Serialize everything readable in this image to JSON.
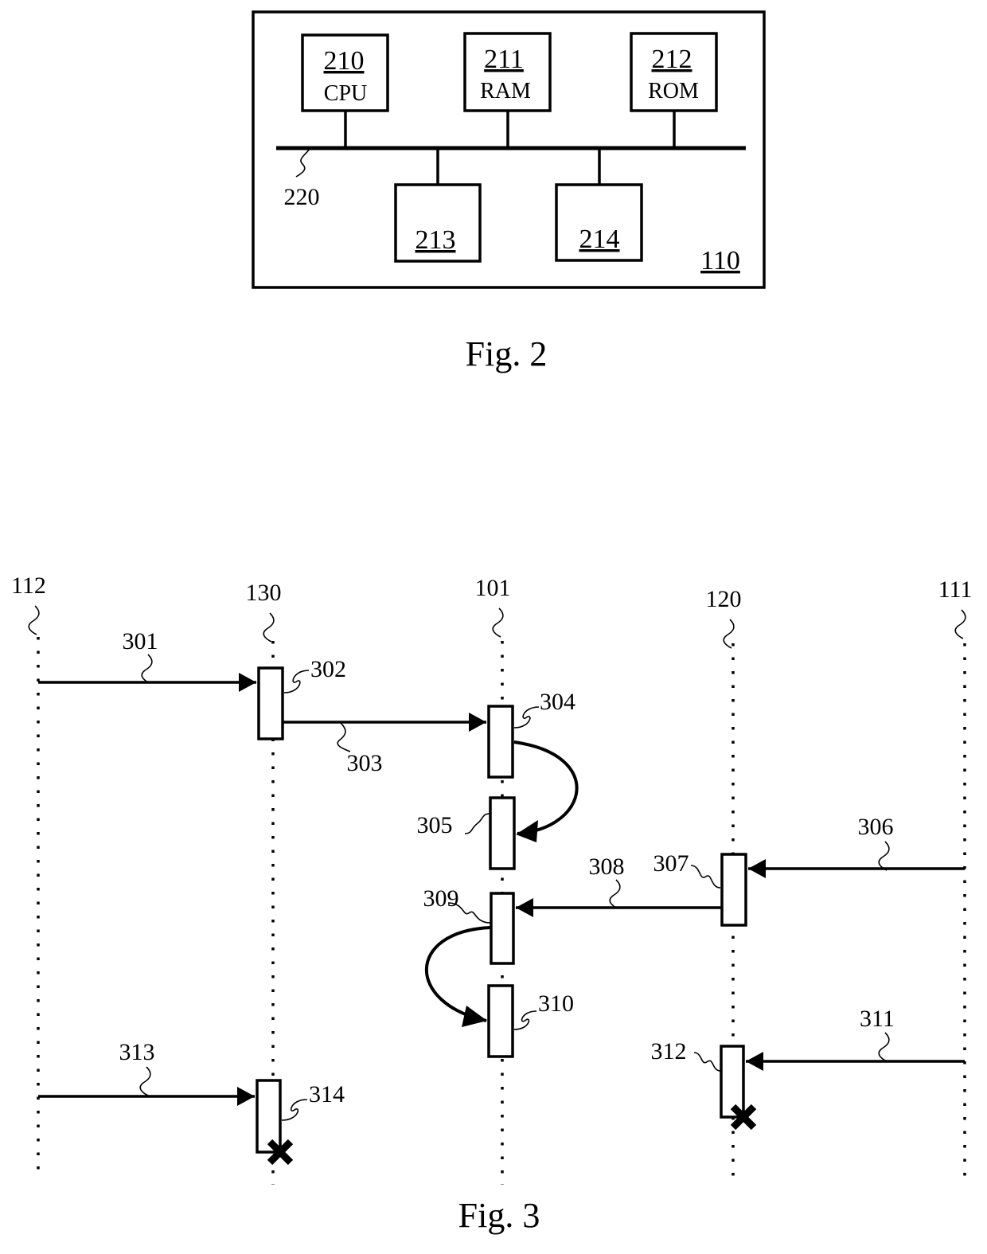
{
  "figure2": {
    "caption": "Fig. 2",
    "container_ref": "110",
    "bus_ref": "220",
    "components": [
      {
        "ref": "210",
        "label": "CPU",
        "position": "top"
      },
      {
        "ref": "211",
        "label": "RAM",
        "position": "top"
      },
      {
        "ref": "212",
        "label": "ROM",
        "position": "top"
      },
      {
        "ref": "213",
        "label": "",
        "position": "bottom"
      },
      {
        "ref": "214",
        "label": "",
        "position": "bottom"
      }
    ]
  },
  "figure3": {
    "caption": "Fig. 3",
    "lifelines": [
      {
        "ref": "112"
      },
      {
        "ref": "130"
      },
      {
        "ref": "101"
      },
      {
        "ref": "120"
      },
      {
        "ref": "111"
      }
    ],
    "activations": [
      {
        "ref": "302",
        "lifeline": "130",
        "terminated": false
      },
      {
        "ref": "304",
        "lifeline": "101",
        "terminated": false
      },
      {
        "ref": "305",
        "lifeline": "101",
        "terminated": false
      },
      {
        "ref": "307",
        "lifeline": "120",
        "terminated": false
      },
      {
        "ref": "309",
        "lifeline": "101",
        "terminated": false
      },
      {
        "ref": "310",
        "lifeline": "101",
        "terminated": false
      },
      {
        "ref": "312",
        "lifeline": "120",
        "terminated": true
      },
      {
        "ref": "314",
        "lifeline": "130",
        "terminated": true
      }
    ],
    "messages": [
      {
        "ref": "301",
        "from": "112",
        "to": "302",
        "kind": "straight"
      },
      {
        "ref": "303",
        "from": "302",
        "to": "304",
        "kind": "straight"
      },
      {
        "ref": "",
        "from": "304",
        "to": "305",
        "kind": "self-curve-right"
      },
      {
        "ref": "306",
        "from": "111",
        "to": "307",
        "kind": "straight"
      },
      {
        "ref": "308",
        "from": "307",
        "to": "309",
        "kind": "straight"
      },
      {
        "ref": "",
        "from": "309",
        "to": "310",
        "kind": "self-curve-left"
      },
      {
        "ref": "311",
        "from": "111",
        "to": "312",
        "kind": "straight"
      },
      {
        "ref": "313",
        "from": "112",
        "to": "314",
        "kind": "straight"
      }
    ]
  }
}
